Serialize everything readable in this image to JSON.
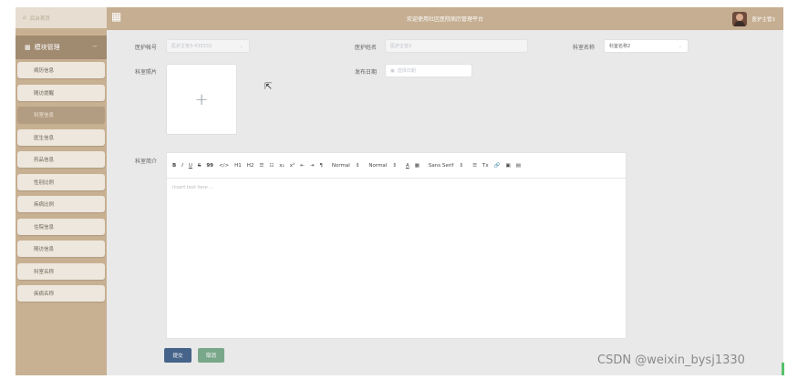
{
  "sidebar": {
    "home_label": "后台首页",
    "module_label": "模块管理",
    "menu_items": [
      "病历信息",
      "随访提醒",
      "科室信息",
      "医生信息",
      "药品信息",
      "性别比例",
      "疾病比例",
      "住院信息",
      "随访信息",
      "科室名称",
      "疾病名称"
    ],
    "active_item": "科室信息"
  },
  "topbar": {
    "title": "欢迎使用社区医院病历管理平台",
    "user_name": "医护主管3"
  },
  "form": {
    "account_label": "医护帐号",
    "account_placeholder": "医护主管3-435333",
    "name_label": "医护姓名",
    "name_placeholder": "医护主管3",
    "dept_label": "科室名称",
    "dept_value": "科室名称2",
    "photo_label": "科室照片",
    "date_label": "发布日期",
    "date_placeholder": "选择日期",
    "intro_label": "科室简介"
  },
  "editor": {
    "toolbar": [
      "B",
      "I",
      "U",
      "S",
      "99",
      "</>",
      "H1",
      "H2",
      "☰",
      "☷",
      "x₂",
      "x²",
      "⇤",
      "⇥",
      "¶",
      "Normal",
      "Normal",
      "A",
      "▦",
      "Sans Serif",
      "☰",
      "Tx",
      "🔗",
      "▣",
      "▤"
    ],
    "placeholder": "Insert text here ..."
  },
  "buttons": {
    "submit": "提交",
    "cancel": "取消"
  },
  "watermark": "CSDN @weixin_bysj1330",
  "colors": {
    "topbar": "#c5ae91",
    "sidebar": "#c8b092",
    "submit": "#46648a",
    "cancel": "#79a78a"
  }
}
